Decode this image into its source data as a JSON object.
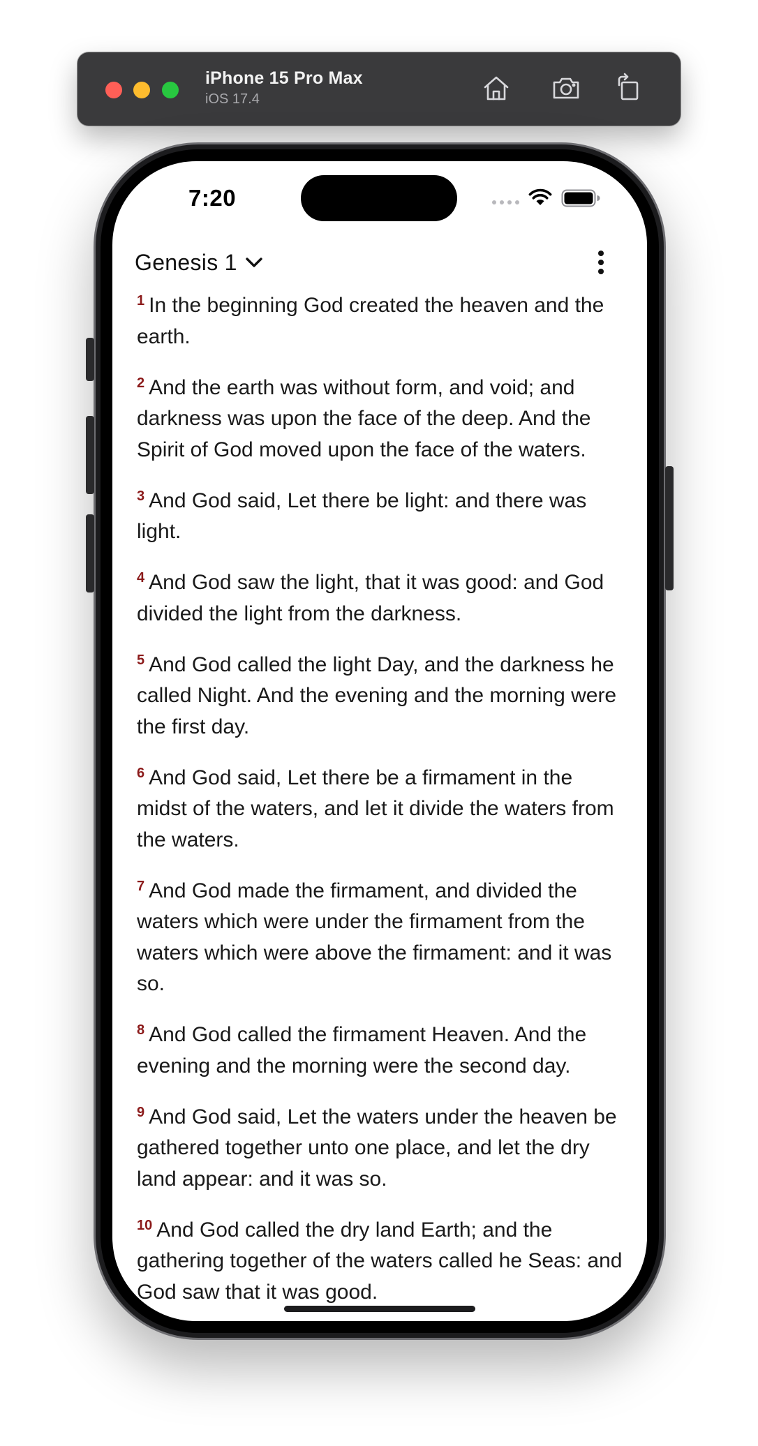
{
  "simulator": {
    "device_name": "iPhone 15 Pro Max",
    "os_version": "iOS 17.4",
    "icons": [
      "home-icon",
      "screenshot-icon",
      "rotate-icon"
    ]
  },
  "status_bar": {
    "time": "7:20"
  },
  "header": {
    "chapter_title": "Genesis 1",
    "chevron_icon": "chevron-down-icon",
    "more_icon": "more-vertical-icon"
  },
  "colors": {
    "verse_number": "#8b1a1a",
    "text": "#1a1a1a",
    "simulator_bar": "#3a3a3c"
  },
  "verses": [
    {
      "num": "1",
      "text": "In the beginning God created the heaven and the earth."
    },
    {
      "num": "2",
      "text": "And the earth was without form, and void; and darkness was upon the face of the deep. And the Spirit of God moved upon the face of the waters."
    },
    {
      "num": "3",
      "text": "And God said, Let there be light: and there was light."
    },
    {
      "num": "4",
      "text": "And God saw the light, that it was good: and God divided the light from the darkness."
    },
    {
      "num": "5",
      "text": "And God called the light Day, and the darkness he called Night. And the evening and the morning were the first day."
    },
    {
      "num": "6",
      "text": "And God said, Let there be a firmament in the midst of the waters, and let it divide the waters from the waters."
    },
    {
      "num": "7",
      "text": "And God made the firmament, and divided the waters which were under the firmament from the waters which were above the firmament: and it was so."
    },
    {
      "num": "8",
      "text": "And God called the firmament Heaven. And the evening and the morning were the second day."
    },
    {
      "num": "9",
      "text": "And God said, Let the waters under the heaven be gathered together unto one place, and let the dry land appear: and it was so."
    },
    {
      "num": "10",
      "text": "And God called the dry land Earth; and the gathering together of the waters called he Seas: and God saw that it was good."
    }
  ]
}
